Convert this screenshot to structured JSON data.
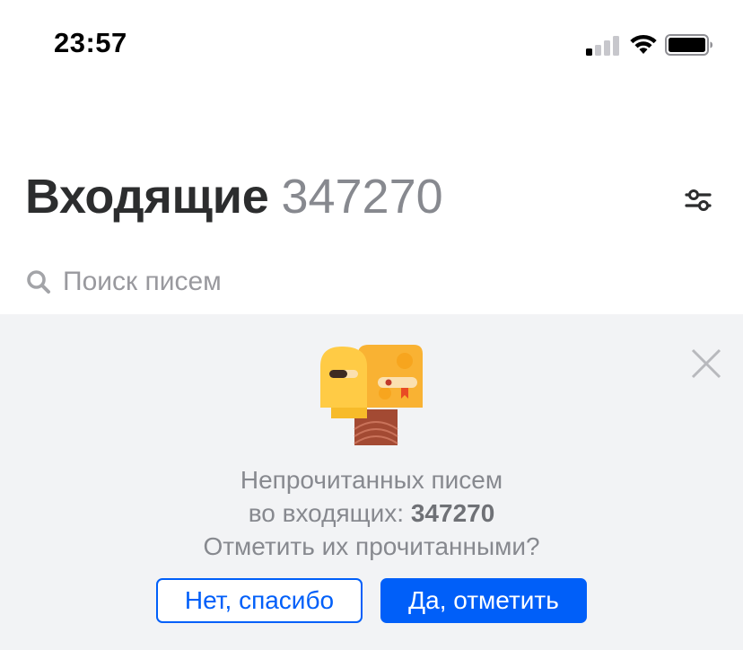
{
  "status_bar": {
    "time": "23:57",
    "signal_icon": "cellular-signal-icon",
    "wifi_icon": "wifi-icon",
    "battery_icon": "battery-icon"
  },
  "header": {
    "title": "Входящие",
    "count": "347270",
    "filter_icon": "filter-sliders-icon"
  },
  "search": {
    "placeholder": "Поиск писем",
    "value": "",
    "icon": "search-icon"
  },
  "promo": {
    "close_icon": "close-icon",
    "mascot_icon": "mascot-illustration-icon",
    "line1": "Непрочитанных писем",
    "line2_prefix": "во входящих: ",
    "line2_count": "347270",
    "line3": "Отметить их прочитанными?",
    "decline_label": "Нет, спасибо",
    "accept_label": "Да, отметить"
  },
  "colors": {
    "accent": "#005ff9",
    "panel_bg": "#f2f3f5",
    "muted_text": "#87898f"
  }
}
